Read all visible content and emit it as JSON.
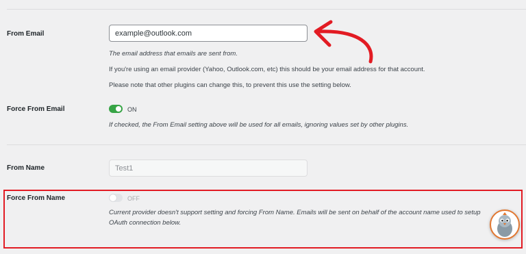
{
  "fields": {
    "from_email": {
      "label": "From Email",
      "value": "example@outlook.com",
      "help": [
        "The email address that emails are sent from.",
        "If you're using an email provider (Yahoo, Outlook.com, etc) this should be your email address for that account.",
        "Please note that other plugins can change this, to prevent this use the setting below."
      ]
    },
    "force_from_email": {
      "label": "Force From Email",
      "toggle_state": "ON",
      "help": "If checked, the From Email setting above will be used for all emails, ignoring values set by other plugins."
    },
    "from_name": {
      "label": "From Name",
      "value": "Test1"
    },
    "force_from_name": {
      "label": "Force From Name",
      "toggle_state": "OFF",
      "help_line1": "Current provider doesn't support setting and forcing From Name. Emails will be sent on behalf of the account name used to setup",
      "help_line2": "OAuth connection below."
    }
  },
  "colors": {
    "toggle_on": "#37a446",
    "annotation_red": "#e21b23",
    "mascot_border": "#e27730"
  },
  "icons": {
    "arrow": "red-curved-arrow-annotation",
    "mascot": "pigeon-mascot-icon"
  }
}
